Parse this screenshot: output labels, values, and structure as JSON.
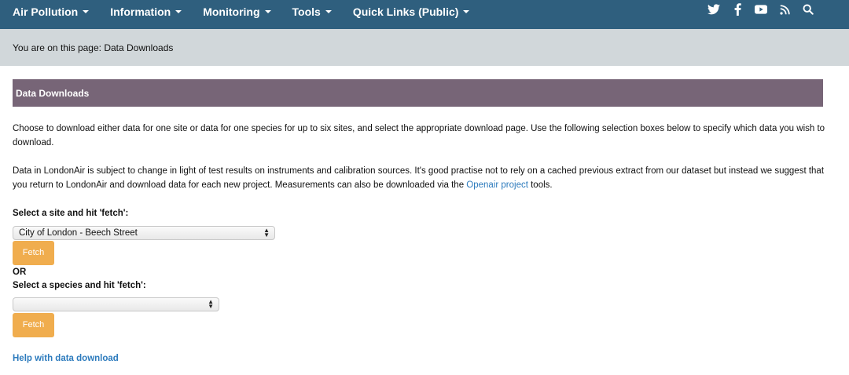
{
  "nav": {
    "items": [
      {
        "label": "Air Pollution"
      },
      {
        "label": "Information"
      },
      {
        "label": "Monitoring"
      },
      {
        "label": "Tools"
      },
      {
        "label": "Quick Links (Public)"
      }
    ],
    "icons": [
      "twitter-icon",
      "facebook-icon",
      "youtube-icon",
      "rss-icon",
      "search-icon"
    ],
    "background": "#2f5f7e"
  },
  "breadcrumb": {
    "text": "You are on this page: Data Downloads"
  },
  "panel": {
    "title": "Data Downloads",
    "color": "#776577"
  },
  "intro": {
    "p1": "Choose to download either data for one site or data for one species for up to six sites, and select the appropriate download page. Use the following selection boxes below to specify which data you wish to download.",
    "p2_before": "Data in LondonAir is subject to change in light of test results on instruments and calibration sources. It's good practise not to rely on a cached previous extract from our dataset but instead we suggest that you return to LondonAir and download data for each new project. Measurements can also be downloaded via the ",
    "p2_link": "Openair project",
    "p2_after": " tools."
  },
  "site_form": {
    "label": "Select a site and hit 'fetch':",
    "selected": "City of London - Beech Street",
    "button": "Fetch"
  },
  "or_text": "OR",
  "species_form": {
    "label": "Select a species and hit 'fetch':",
    "selected": "",
    "button": "Fetch"
  },
  "help_link": "Help with data download",
  "colors": {
    "button": "#f0ad4e",
    "link": "#2d7bbd",
    "breadcrumb_bg": "#d1d7da"
  }
}
